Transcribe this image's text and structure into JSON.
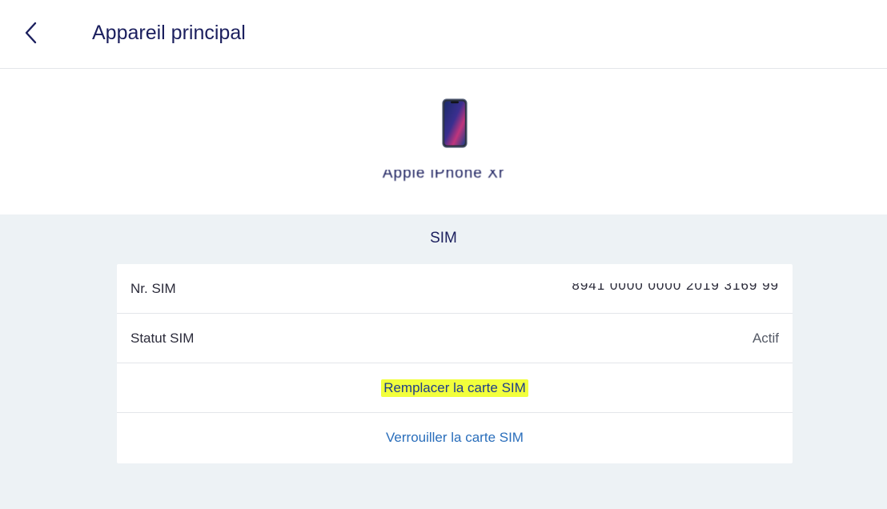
{
  "header": {
    "title": "Appareil principal",
    "back_icon": "chevron-left-icon"
  },
  "device": {
    "image_icon": "smartphone-icon",
    "name": "Apple iPhone Xr"
  },
  "sim": {
    "section_title": "SIM",
    "rows": [
      {
        "label": "Nr. SIM",
        "value": "8941 0000 0000 2019 3169 99"
      },
      {
        "label": "Statut SIM",
        "value": "Actif"
      }
    ],
    "actions": {
      "replace": "Remplacer la carte SIM",
      "lock": "Verrouiller la carte SIM"
    }
  },
  "colors": {
    "title": "#1b1f5e",
    "link": "#2a6ebb",
    "highlight": "#f2ff3c",
    "section_bg": "#edf2f5"
  }
}
